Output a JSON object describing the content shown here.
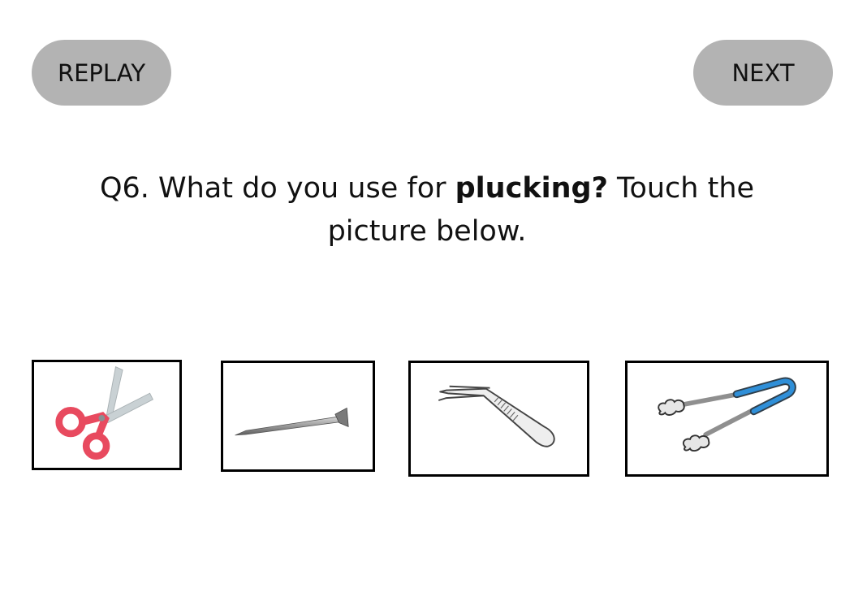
{
  "buttons": {
    "replay_label": "REPLAY",
    "next_label": "NEXT"
  },
  "question": {
    "prefix": "Q6. What do you use for ",
    "keyword": "plucking?",
    "suffix": " Touch the picture below."
  },
  "choices": [
    {
      "icon": "scissors-icon"
    },
    {
      "icon": "nail-icon"
    },
    {
      "icon": "tweezers-icon"
    },
    {
      "icon": "tongs-icon"
    }
  ],
  "colors": {
    "button_bg": "#b3b3b3",
    "scissors_handle": "#e84a5f",
    "tongs_grip": "#2f8fd8"
  }
}
